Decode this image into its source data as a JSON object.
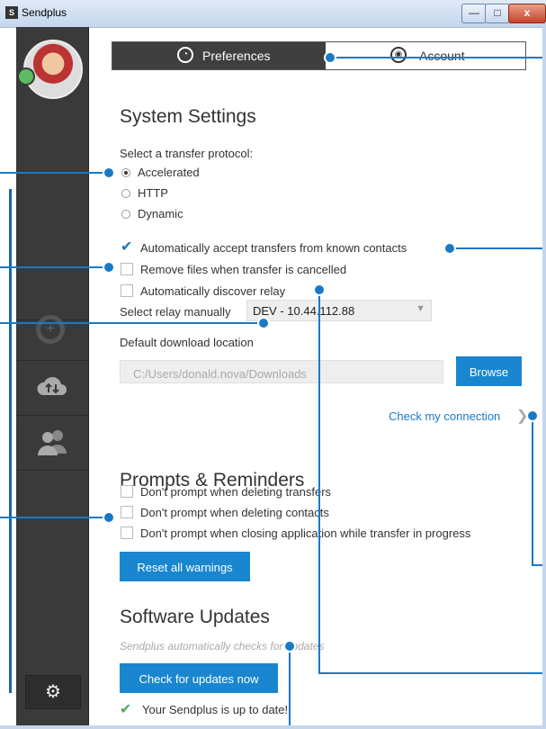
{
  "window": {
    "title": "Sendplus",
    "logo": "S",
    "min": "—",
    "max": "□",
    "close": "x"
  },
  "tabs": {
    "preferences": "Preferences",
    "account": "Account"
  },
  "system": {
    "heading": "System Settings",
    "protocol_label": "Select a transfer protocol:",
    "protocols": [
      "Accelerated",
      "HTTP",
      "Dynamic"
    ],
    "auto_accept": "Automatically accept transfers from known contacts",
    "remove_files": "Remove files when transfer is cancelled",
    "auto_discover": "Automatically discover relay",
    "relay_label": "Select relay manually",
    "relay_value": "DEV - 10.44.112.88",
    "download_label": "Default download location",
    "download_path": "C:/Users/donald.nova/Downloads",
    "browse": "Browse",
    "check_connection": "Check my connection"
  },
  "prompts": {
    "heading": "Prompts & Reminders",
    "items": [
      "Don't prompt when deleting transfers",
      "Don't prompt when deleting contacts",
      "Don't prompt when closing application while transfer in progress"
    ],
    "reset": "Reset all warnings"
  },
  "updates": {
    "heading": "Software Updates",
    "note": "Sendplus automatically checks for updates",
    "check": "Check for updates now",
    "status": "Your Sendplus is up to date!"
  },
  "colors": {
    "accent": "#1a79c4",
    "button": "#1a86cf",
    "sidebar": "#3a3a3a",
    "ok": "#4cae52"
  }
}
